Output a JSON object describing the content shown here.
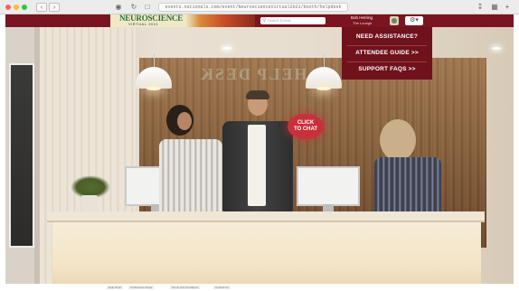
{
  "browser": {
    "url": "events.nationals.com/event/NeuroscienceVirtual2021/booth/helpdesk",
    "back_icon": "chevron-left-icon",
    "forward_icon": "chevron-right-icon"
  },
  "header": {
    "logo_text": "NEUROSCIENCE",
    "logo_sub": "VIRTUAL 2021",
    "search_placeholder": "Search Events",
    "user_name": "Bob Herring",
    "user_location": "The Lounge",
    "gear_icon": "gear-icon"
  },
  "menu": {
    "items": [
      {
        "label": "NEED ASSISTANCE?"
      },
      {
        "label": "ATTENDEE GUIDE >>"
      },
      {
        "label": "SUPPORT FAQS >>"
      }
    ]
  },
  "scene": {
    "sign_text": "HELP DESK",
    "chat_label_1": "CLICK",
    "chat_label_2": "TO CHAT"
  },
  "footer": {
    "links": [
      {
        "label": "Help Desk"
      },
      {
        "label": "Conference Guide"
      },
      {
        "label": "Terms and Conditions"
      },
      {
        "label": "Contact Us"
      }
    ]
  },
  "colors": {
    "brand": "#7a1420",
    "chat": "#c8303a"
  }
}
